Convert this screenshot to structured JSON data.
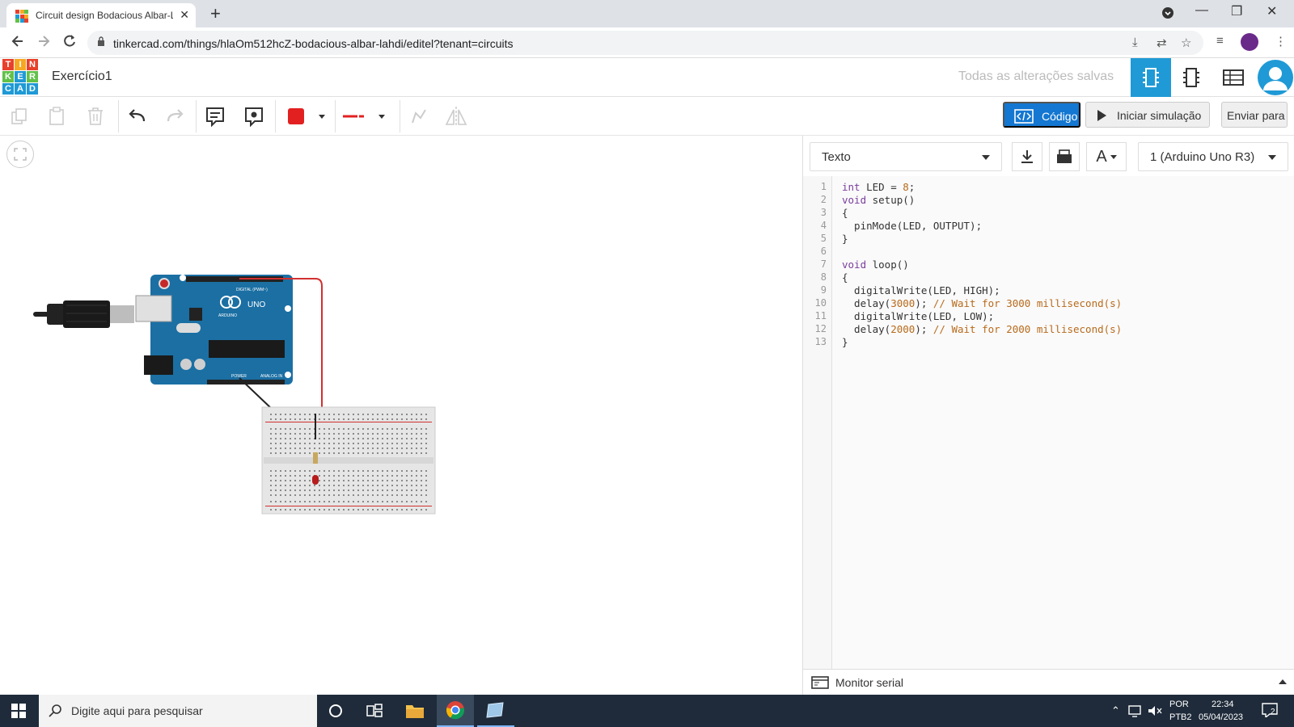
{
  "browser": {
    "tab_title": "Circuit design Bodacious Albar-L",
    "url": "tinkercad.com/things/hlaOm512hcZ-bodacious-albar-lahdi/editel?tenant=circuits"
  },
  "logo": {
    "letters": [
      "T",
      "I",
      "N",
      "K",
      "E",
      "R",
      "C",
      "A",
      "D"
    ]
  },
  "header": {
    "project_title": "Exercício1",
    "save_status": "Todas as alterações salvas"
  },
  "toolbar": {
    "code_label": "Código",
    "simulate_label": "Iniciar simulação",
    "send_label": "Enviar para",
    "color_value": "#e32020"
  },
  "code_panel": {
    "mode_label": "Texto",
    "device_label": "1 (Arduino Uno R3)",
    "font_icon_label": "A",
    "serial_monitor_label": "Monitor serial",
    "line_numbers": [
      "1",
      "2",
      "3",
      "4",
      "5",
      "6",
      "7",
      "8",
      "9",
      "10",
      "11",
      "12",
      "13"
    ],
    "code_lines": [
      [
        {
          "t": "int",
          "c": "kw"
        },
        {
          "t": " LED = ",
          "c": ""
        },
        {
          "t": "8",
          "c": "num"
        },
        {
          "t": ";",
          "c": ""
        }
      ],
      [
        {
          "t": "void",
          "c": "kw"
        },
        {
          "t": " setup()",
          "c": ""
        }
      ],
      [
        {
          "t": "{",
          "c": ""
        }
      ],
      [
        {
          "t": "  pinMode(LED, OUTPUT);",
          "c": ""
        }
      ],
      [
        {
          "t": "}",
          "c": ""
        }
      ],
      [],
      [
        {
          "t": "void",
          "c": "kw"
        },
        {
          "t": " loop()",
          "c": ""
        }
      ],
      [
        {
          "t": "{",
          "c": ""
        }
      ],
      [
        {
          "t": "  digitalWrite(LED, HIGH);",
          "c": ""
        }
      ],
      [
        {
          "t": "  delay(",
          "c": ""
        },
        {
          "t": "3000",
          "c": "num"
        },
        {
          "t": "); ",
          "c": ""
        },
        {
          "t": "// Wait for 3000 millisecond(s)",
          "c": "cm"
        }
      ],
      [
        {
          "t": "  digitalWrite(LED, LOW);",
          "c": ""
        }
      ],
      [
        {
          "t": "  delay(",
          "c": ""
        },
        {
          "t": "2000",
          "c": "num"
        },
        {
          "t": "); ",
          "c": ""
        },
        {
          "t": "// Wait for 2000 millisecond(s)",
          "c": "cm"
        }
      ],
      [
        {
          "t": "}",
          "c": ""
        }
      ]
    ]
  },
  "circuit": {
    "board_logo_text": "UNO",
    "board_brand_text": "ARDUINO",
    "digital_label": "DIGITAL (PWM~)",
    "power_label": "POWER",
    "analog_label": "ANALOG IN"
  },
  "taskbar": {
    "search_placeholder": "Digite aqui para pesquisar",
    "lang_top": "POR",
    "lang_bottom": "PTB2",
    "time": "22:34",
    "date": "05/04/2023",
    "notification_count": "2"
  },
  "icons": [
    "windows-start-icon",
    "search-icon",
    "cortana-icon",
    "task-view-icon",
    "file-explorer-icon",
    "chrome-icon",
    "app-icon",
    "undo-icon",
    "redo-icon",
    "copy-icon",
    "paste-icon",
    "delete-icon",
    "note-icon",
    "eye-icon",
    "flip-icon",
    "download-icon",
    "print-icon",
    "fit-view-icon"
  ]
}
